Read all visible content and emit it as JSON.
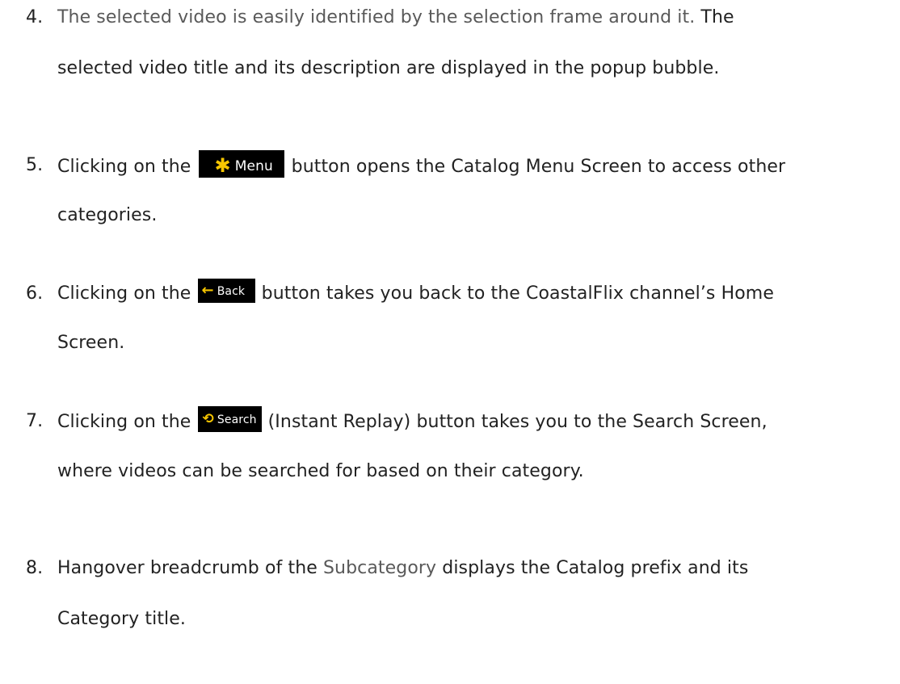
{
  "items": [
    {
      "number": "4.",
      "line1_part1": "The selected video is easily identified by the selection frame around it.",
      "line1_part2": " The",
      "line2": "selected video title and its description are displayed in the popup bubble."
    },
    {
      "number": "5.",
      "line1_before": "Clicking on the ",
      "button_label": "Menu",
      "button_icon": "asterisk-icon",
      "line1_after": " button opens the Catalog Menu Screen to access other",
      "line2": "categories."
    },
    {
      "number": "6.",
      "line1_before": "Clicking on the ",
      "button_label": "Back",
      "button_icon": "arrow-left-icon",
      "line1_after": " button takes you back to the CoastalFlix channel’s Home",
      "line2": "Screen."
    },
    {
      "number": "7.",
      "line1_before": "Clicking on the ",
      "button_label": "Search",
      "button_icon": "instant-replay-icon",
      "line1_after": " (Instant Replay) button takes you to the Search Screen,",
      "line2": "where videos can be searched for based on their category."
    },
    {
      "number": "8.",
      "line1_before": "Hangover breadcrumb of the ",
      "line1_link": "Subcategory",
      "line1_after": " displays the Catalog prefix and its",
      "line2": "Category title."
    }
  ],
  "colors": {
    "text": "#222222",
    "muted": "#595959",
    "button_bg": "#000000",
    "button_icon": "#f7c600"
  }
}
